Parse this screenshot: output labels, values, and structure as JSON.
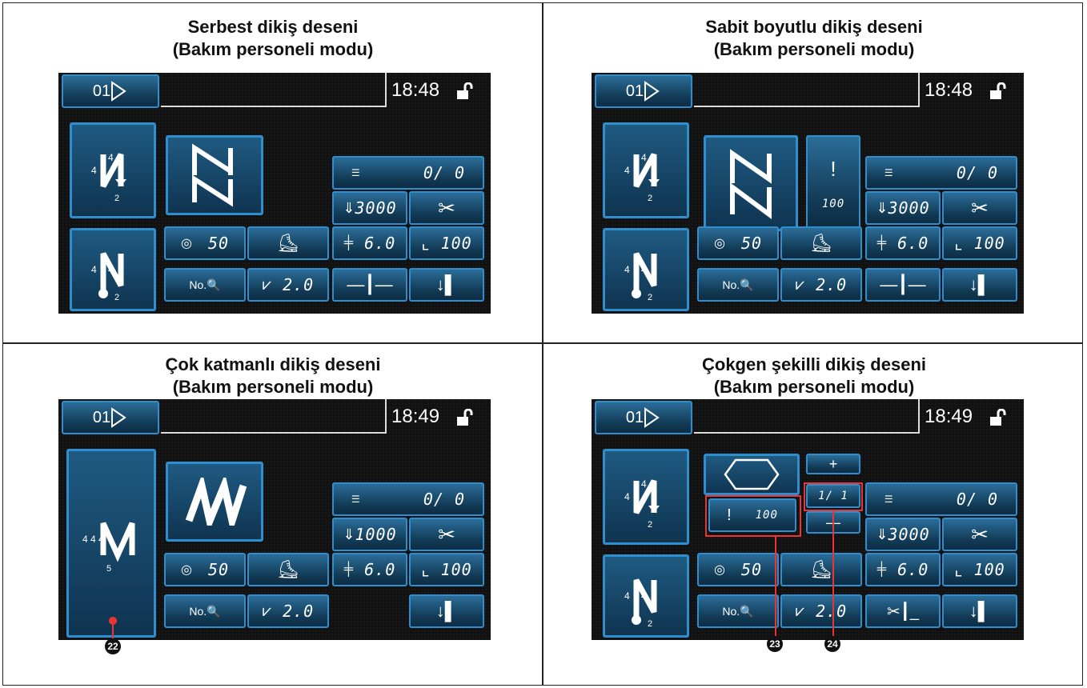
{
  "panels": [
    {
      "title1": "Serbest dikiş deseni",
      "title2": "(Bakım personeli modu)",
      "pattern_no": "01",
      "time": "18:48",
      "counter": "0/  0",
      "speed": "3000",
      "tension": "50",
      "pitch": "6.0",
      "presser": "100",
      "lift": "2.0"
    },
    {
      "title1": "Sabit boyutlu dikiş deseni",
      "title2": "(Bakım personeli modu)",
      "pattern_no": "01",
      "time": "18:48",
      "counter": "0/  0",
      "speed": "3000",
      "tension": "50",
      "pitch": "6.0",
      "presser": "100",
      "lift": "2.0",
      "needle_count": "100"
    },
    {
      "title1": "Çok katmanlı dikiş deseni",
      "title2": "(Bakım personeli modu)",
      "pattern_no": "01",
      "time": "18:49",
      "counter": "0/  0",
      "speed": "1000",
      "tension": "50",
      "pitch": "6.0",
      "presser": "100",
      "lift": "2.0",
      "callout": "22"
    },
    {
      "title1": "Çokgen şekilli dikiş deseni",
      "title2": "(Bakım personeli modu)",
      "pattern_no": "01",
      "time": "18:49",
      "counter": "0/  0",
      "speed": "3000",
      "tension": "50",
      "pitch": "6.0",
      "presser": "100",
      "lift": "2.0",
      "needle_count": "100",
      "step": "1/  1",
      "callout_a": "23",
      "callout_b": "24"
    }
  ],
  "icons": {
    "scissors": "✂"
  }
}
